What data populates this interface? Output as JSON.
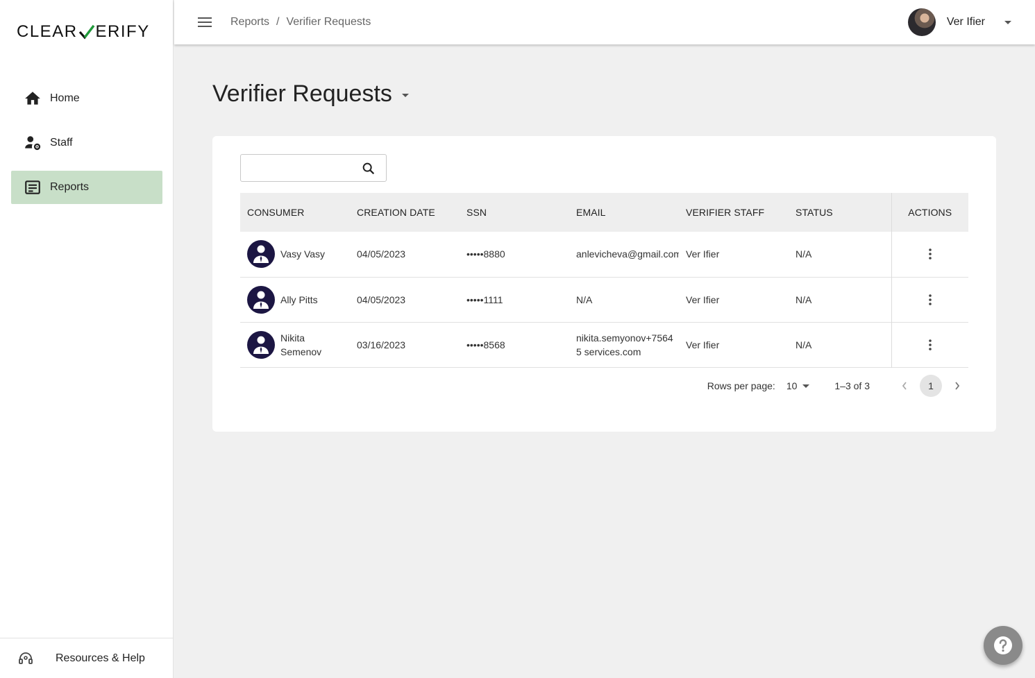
{
  "brand": {
    "logo_left": "CLEAR",
    "logo_right": "ERIFY",
    "check_color": "#1f9d3a"
  },
  "sidebar": {
    "items": [
      {
        "label": "Home",
        "icon": "home-icon"
      },
      {
        "label": "Staff",
        "icon": "staff-gear-icon"
      },
      {
        "label": "Reports",
        "icon": "reports-icon",
        "active": true
      }
    ],
    "help_label": "Resources & Help"
  },
  "header": {
    "breadcrumb": [
      "Reports",
      "Verifier Requests"
    ],
    "separator": "/",
    "user_name": "Ver Ifier"
  },
  "page": {
    "title": "Verifier Requests"
  },
  "search": {
    "placeholder": "",
    "value": ""
  },
  "table": {
    "columns": [
      "CONSUMER",
      "CREATION DATE",
      "SSN",
      "EMAIL",
      "VERIFIER STAFF",
      "STATUS",
      "ACTIONS"
    ],
    "rows": [
      {
        "consumer": "Vasy Vasy",
        "date": "04/05/2023",
        "ssn": "•••••8880",
        "email": "anlevicheva@gmail.com",
        "staff": "Ver Ifier",
        "status": "N/A"
      },
      {
        "consumer": "Ally Pitts",
        "date": "04/05/2023",
        "ssn": "•••••1111",
        "email": "N/A",
        "staff": "Ver Ifier",
        "status": "N/A"
      },
      {
        "consumer": "Nikita Semenov",
        "date": "03/16/2023",
        "ssn": "•••••8568",
        "email": "nikita.semyonov+75645 services.com",
        "staff": "Ver Ifier",
        "status": "N/A"
      }
    ]
  },
  "pagination": {
    "rows_label": "Rows per page:",
    "rows_value": "10",
    "range": "1–3 of 3",
    "current_page": "1"
  },
  "colors": {
    "active_nav": "#c8dfc8",
    "avatar_bg": "#1c1643",
    "fab": "#8a8a8a"
  }
}
